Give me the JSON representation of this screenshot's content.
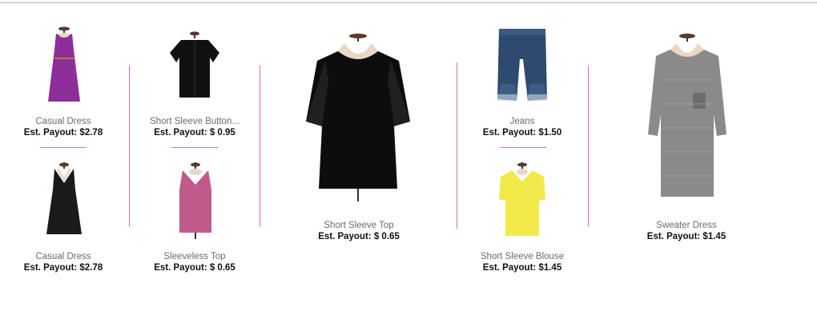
{
  "items": [
    {
      "name": "Casual Dress",
      "payout": "Est. Payout: $2.78",
      "color": "#8e2e9a"
    },
    {
      "name": "Casual Dress",
      "payout": "Est. Payout: $2.78",
      "color": "#1a1a1a"
    },
    {
      "name": "Short Sleeve Button...",
      "payout": "Est. Payout: $ 0.95",
      "color": "#111111"
    },
    {
      "name": "Sleeveless Top",
      "payout": "Est. Payout: $ 0.65",
      "color": "#c05a8a"
    },
    {
      "name": "Short Sleeve Top",
      "payout": "Est. Payout: $ 0.65",
      "color": "#0d0d0d"
    },
    {
      "name": "Jeans",
      "payout": "Est. Payout: $1.50",
      "color": "#2e4a6e"
    },
    {
      "name": "Short Sleeve Blouse",
      "payout": "Est. Payout: $1.45",
      "color": "#f2e94a"
    },
    {
      "name": "Sweater Dress",
      "payout": "Est. Payout: $1.45",
      "color": "#8a8a8a"
    }
  ],
  "accent": "#d86fb8"
}
